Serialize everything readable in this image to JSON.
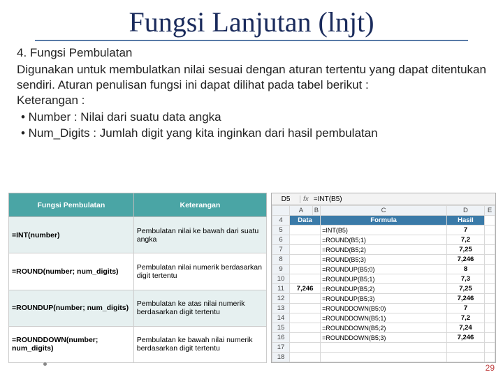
{
  "title": "Fungsi Lanjutan (lnjt)",
  "section": "4. Fungsi Pembulatan",
  "desc": "Digunakan untuk membulatkan nilai sesuai dengan aturan tertentu yang dapat ditentukan sendiri. Aturan penulisan fungsi ini dapat dilihat pada tabel berikut :",
  "ket": "Keterangan :",
  "b1": "•  Number : Nilai dari suatu data angka",
  "b2": "•  Num_Digits : Jumlah digit yang kita inginkan dari hasil pembulatan",
  "ref": {
    "h1": "Fungsi Pembulatan",
    "h2": "Keterangan",
    "rows": [
      {
        "f": "=INT(number)",
        "k": "Pembulatan nilai ke bawah dari suatu angka"
      },
      {
        "f": "=ROUND(number; num_digits)",
        "k": "Pembulatan nilai numerik berdasarkan digit tertentu"
      },
      {
        "f": "=ROUNDUP(number; num_digits)",
        "k": "Pembulatan ke atas nilai numerik berdasarkan digit tertentu"
      },
      {
        "f": "=ROUNDDOWN(number; num_digits)",
        "k": "Pembulatan ke bawah nilai numerik berdasarkan digit tertentu"
      }
    ]
  },
  "formula": {
    "cell": "D5",
    "fx": "fx",
    "val": "=INT(B5)"
  },
  "cols": [
    "",
    "A",
    "B",
    "C",
    "D",
    "E"
  ],
  "sheet": {
    "hdr": {
      "n": "4",
      "A": "Data",
      "C": "Formula",
      "D": "Hasil"
    },
    "rows": [
      {
        "n": "5",
        "C": "=INT(B5)",
        "D": "7"
      },
      {
        "n": "6",
        "C": "=ROUND(B5;1)",
        "D": "7,2"
      },
      {
        "n": "7",
        "C": "=ROUND(B5;2)",
        "D": "7,25"
      },
      {
        "n": "8",
        "C": "=ROUND(B5;3)",
        "D": "7,246"
      },
      {
        "n": "9",
        "C": "=ROUNDUP(B5;0)",
        "D": "8"
      },
      {
        "n": "10",
        "C": "=ROUNDUP(B5;1)",
        "D": "7,3"
      },
      {
        "n": "11",
        "A": "7,246",
        "C": "=ROUNDUP(B5;2)",
        "D": "7,25"
      },
      {
        "n": "12",
        "C": "=ROUNDUP(B5;3)",
        "D": "7,246"
      },
      {
        "n": "13",
        "C": "=ROUNDDOWN(B5;0)",
        "D": "7"
      },
      {
        "n": "14",
        "C": "=ROUNDDOWN(B5;1)",
        "D": "7,2"
      },
      {
        "n": "15",
        "C": "=ROUNDDOWN(B5;2)",
        "D": "7,24"
      },
      {
        "n": "16",
        "C": "=ROUNDDOWN(B5;3)",
        "D": "7,246"
      },
      {
        "n": "17"
      },
      {
        "n": "18"
      }
    ]
  },
  "page": "29",
  "chart_data": {
    "type": "table",
    "title": "Fungsi Pembulatan – contoh",
    "input": 7.246,
    "rows": [
      {
        "formula": "=INT(B5)",
        "hasil": "7"
      },
      {
        "formula": "=ROUND(B5;1)",
        "hasil": "7,2"
      },
      {
        "formula": "=ROUND(B5;2)",
        "hasil": "7,25"
      },
      {
        "formula": "=ROUND(B5;3)",
        "hasil": "7,246"
      },
      {
        "formula": "=ROUNDUP(B5;0)",
        "hasil": "8"
      },
      {
        "formula": "=ROUNDUP(B5;1)",
        "hasil": "7,3"
      },
      {
        "formula": "=ROUNDUP(B5;2)",
        "hasil": "7,25"
      },
      {
        "formula": "=ROUNDUP(B5;3)",
        "hasil": "7,246"
      },
      {
        "formula": "=ROUNDDOWN(B5;0)",
        "hasil": "7"
      },
      {
        "formula": "=ROUNDDOWN(B5;1)",
        "hasil": "7,2"
      },
      {
        "formula": "=ROUNDDOWN(B5;2)",
        "hasil": "7,24"
      },
      {
        "formula": "=ROUNDDOWN(B5;3)",
        "hasil": "7,246"
      }
    ]
  }
}
